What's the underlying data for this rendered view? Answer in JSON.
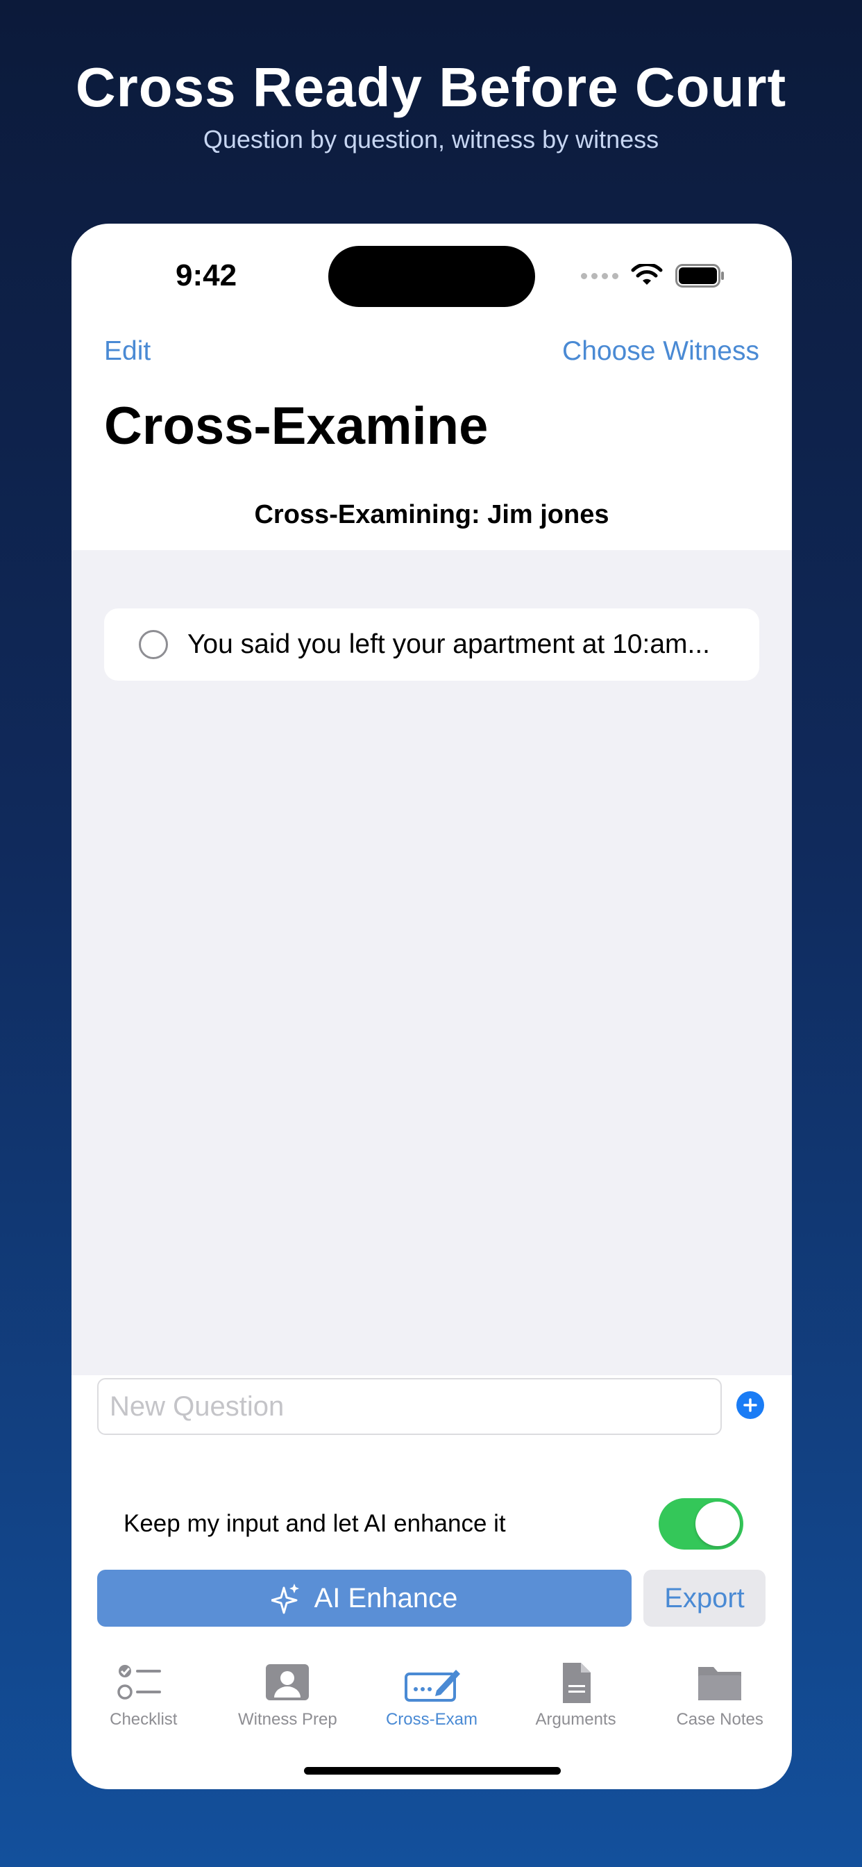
{
  "promo": {
    "title": "Cross Ready Before Court",
    "subtitle": "Question by question, witness by witness"
  },
  "status_bar": {
    "time": "9:42",
    "icons": [
      "signal-icon",
      "wifi-icon",
      "battery-icon"
    ]
  },
  "nav": {
    "left_label": "Edit",
    "right_label": "Choose Witness",
    "title": "Cross-Examine"
  },
  "witness_header": "Cross-Examining: Jim jones",
  "questions": [
    {
      "text": "You said you left your apartment at 10:am...",
      "checked": false
    }
  ],
  "new_question": {
    "placeholder": "New Question",
    "value": ""
  },
  "ai_toggle": {
    "label": "Keep my input and let AI enhance it",
    "on": true
  },
  "buttons": {
    "ai_enhance": "AI Enhance",
    "export": "Export"
  },
  "tabs": [
    {
      "label": "Checklist",
      "icon": "checklist-icon",
      "active": false
    },
    {
      "label": "Witness Prep",
      "icon": "person-card-icon",
      "active": false
    },
    {
      "label": "Cross-Exam",
      "icon": "signature-icon",
      "active": true
    },
    {
      "label": "Arguments",
      "icon": "document-icon",
      "active": false
    },
    {
      "label": "Case Notes",
      "icon": "folder-icon",
      "active": false
    }
  ],
  "colors": {
    "accent": "#4a8ad4",
    "toggle_on": "#34c759",
    "add_button": "#1a7cf5",
    "ai_button": "#5a8fd6"
  }
}
